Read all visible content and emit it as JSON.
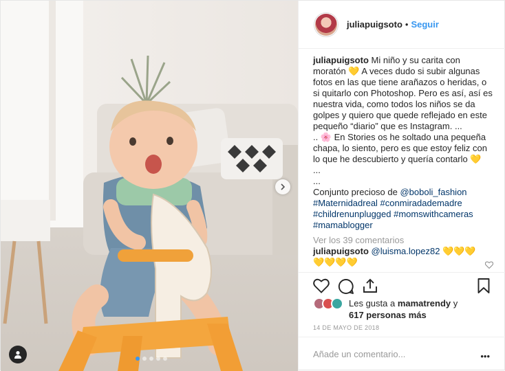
{
  "post": {
    "author": "juliapuigsoto",
    "follow_label": "Seguir",
    "separator": "•",
    "caption": "Mi niño y su carita con moratón 💛 A veces dudo si subir algunas fotos en las que tiene arañazos o heridas, o si quitarlo con Photoshop. Pero es así, así es nuestra vida, como todos los niños se da golpes y quiero que quede reflejado en este pequeño “diario” que es Instagram. ...\n.. 🌸 En Stories os he soltado una pequeña chapa, lo siento, pero es que estoy feliz con lo que he descubierto y quería contarlo 💛\n...\n...",
    "caption_lead": "Conjunto precioso de ",
    "mention": "@boboli_fashion",
    "hashtags": "#Maternidadreal #conmiradademadre #childrenunplugged #momswithcameras #mamablogger",
    "view_comments": "Ver los 39 comentarios",
    "reply": {
      "author": "juliapuigsoto",
      "mention": "@luisma.lopez82",
      "text": " 💛💛💛\n💛💛💛💛"
    },
    "likes_prefix": "Les gusta a ",
    "likes_user": "mamatrendy",
    "likes_conj": " y",
    "likes_others": "617 personas más",
    "date": "14 de mayo de 2018",
    "add_comment_placeholder": "Añade un comentario...",
    "more_label": "•••"
  },
  "carousel": {
    "slides": 5,
    "active": 0
  },
  "icons": {
    "next": "chevron-right-icon",
    "user_tag": "user-icon",
    "like": "heart-icon",
    "comment": "comment-icon",
    "share": "share-icon",
    "save": "bookmark-icon"
  },
  "colors": {
    "accent": "#3897f0",
    "text": "#262626",
    "muted": "#999999"
  }
}
